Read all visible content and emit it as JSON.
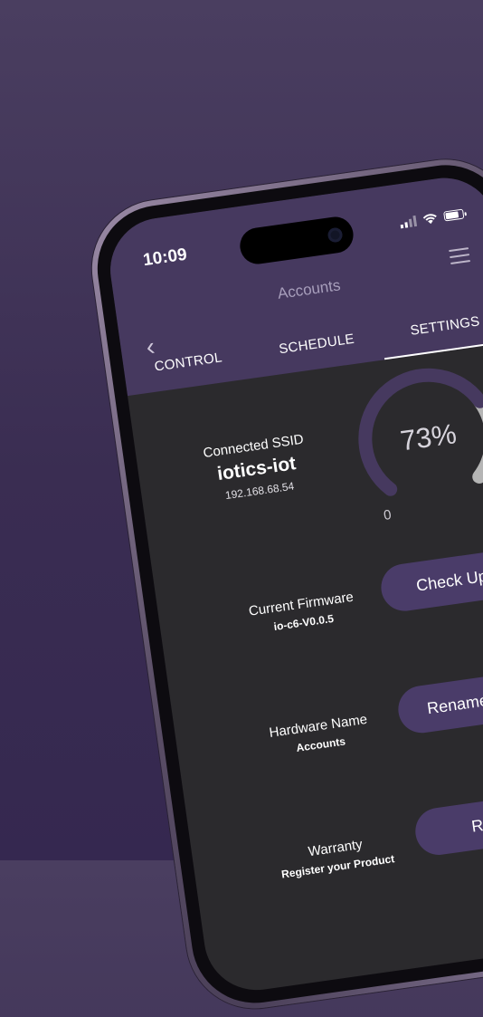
{
  "status_bar": {
    "time": "10:09"
  },
  "header": {
    "title": "Accounts",
    "back_icon": "chevron-left-icon",
    "menu_icon": "hamburger-icon"
  },
  "tabs": [
    {
      "label": "CONTROL",
      "active": false
    },
    {
      "label": "SCHEDULE",
      "active": false
    },
    {
      "label": "SETTINGS",
      "active": true
    }
  ],
  "connection": {
    "label": "Connected SSID",
    "ssid": "iotics-iot",
    "ip": "192.168.68.54"
  },
  "gauge": {
    "value_text": "73%",
    "value": 73,
    "min": "0",
    "max": "100",
    "accent": "#46395f",
    "remaining": "#b5b5b5"
  },
  "firmware": {
    "label": "Current Firmware",
    "value": "io-c6-V0.0.5",
    "button": "Check Update"
  },
  "hardware": {
    "label": "Hardware Name",
    "value": "Accounts",
    "button": "Rename Device"
  },
  "warranty": {
    "label": "Warranty",
    "value": "Register your Product",
    "button": "Register"
  },
  "colors": {
    "background": "#3a2d52",
    "app_bar": "#46395f",
    "screen": "#2b2a2d",
    "button": "#4a3c69"
  }
}
